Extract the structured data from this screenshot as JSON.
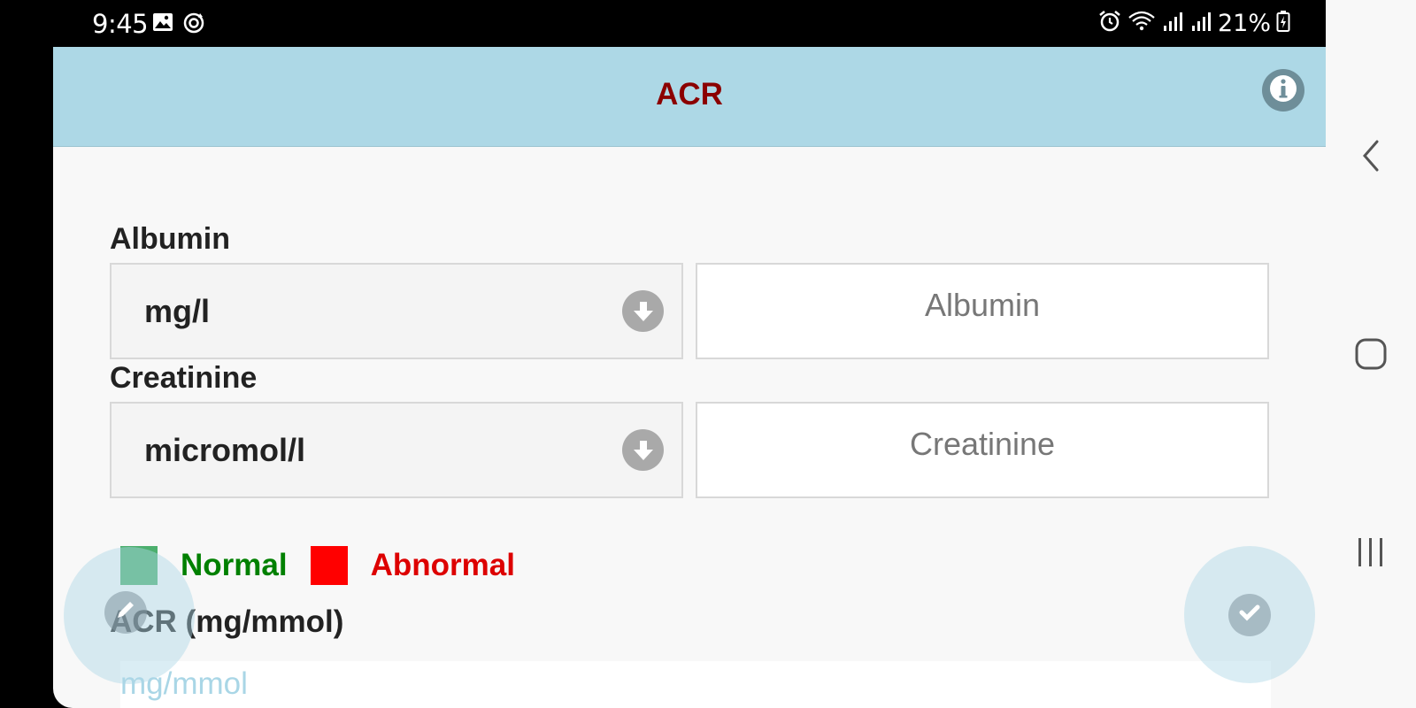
{
  "status_bar": {
    "time": "9:45",
    "battery": "21%",
    "icons": [
      "gallery-icon",
      "sync-icon",
      "alarm-icon",
      "wifi-icon",
      "signal-icon",
      "signal-icon",
      "battery-icon"
    ]
  },
  "header": {
    "title": "ACR",
    "info_icon": "info-icon"
  },
  "albumin": {
    "label": "Albumin",
    "unit": "mg/l",
    "placeholder": "Albumin"
  },
  "creatinine": {
    "label": "Creatinine",
    "unit": "micromol/l",
    "placeholder": "Creatinine"
  },
  "legend": {
    "normal": "Normal",
    "abnormal": "Abnormal",
    "normal_color": "#3cb371",
    "abnormal_color": "#ff0000",
    "normal_text_color": "#008000",
    "abnormal_text_color": "#dd0000"
  },
  "result": {
    "label": "ACR (mg/mmol)",
    "placeholder": "mg/mmol"
  },
  "colors": {
    "header_bg": "#add8e6",
    "title": "#8b0000"
  },
  "nav": {
    "back": "back-icon",
    "home": "home-icon",
    "recents": "recents-icon"
  }
}
